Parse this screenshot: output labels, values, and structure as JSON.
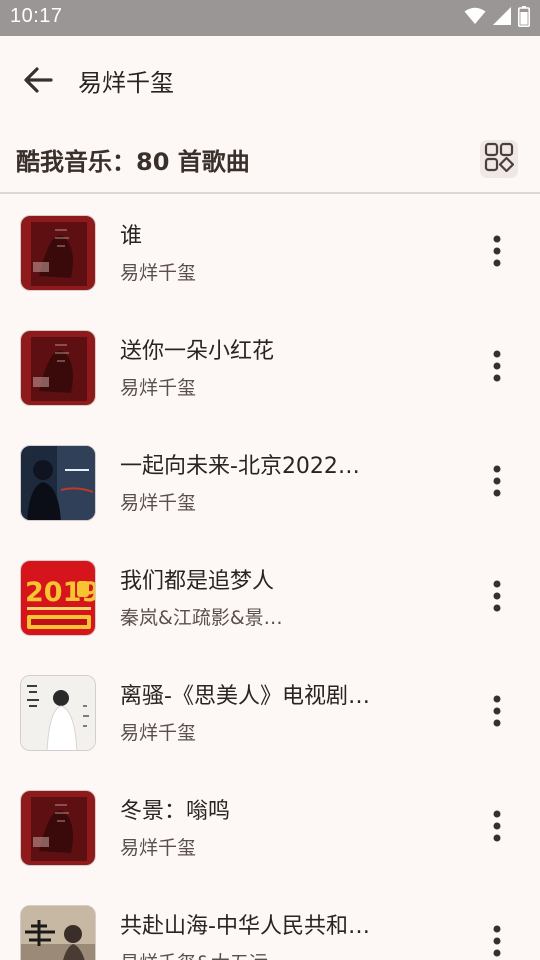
{
  "status_bar": {
    "time": "10:17",
    "icons": [
      "wifi-icon",
      "cellular-signal-icon",
      "battery-icon"
    ]
  },
  "app_bar": {
    "back_icon": "arrow-left-icon",
    "title": "易烊千玺"
  },
  "section": {
    "title": "酷我音乐：80 首歌曲",
    "view_toggle_icon": "grid-view-icon"
  },
  "songs": [
    {
      "title": "谁",
      "artist": "易烊千玺",
      "cover": "red-poster-cover"
    },
    {
      "title": "送你一朵小红花",
      "artist": "易烊千玺",
      "cover": "red-poster-cover"
    },
    {
      "title": "一起向未来-北京2022…",
      "artist": "易烊千玺",
      "cover": "dark-portrait-cover"
    },
    {
      "title": "我们都是追梦人",
      "artist": "秦岚&江疏影&景…",
      "cover": "spring-gala-2019-cover"
    },
    {
      "title": "离骚-《思美人》电视剧…",
      "artist": "易烊千玺",
      "cover": "white-costume-cover"
    },
    {
      "title": "冬景：嗡鸣",
      "artist": "易烊千玺",
      "cover": "red-poster-cover"
    },
    {
      "title": "共赴山海-中华人民共和…",
      "artist": "易烊千玺&大五运",
      "cover": "shanhai-calligraphy-cover"
    }
  ],
  "colors": {
    "background": "#fdf8f6",
    "status_bar": "#9a9695",
    "divider": "#dcd6d4",
    "text_primary": "#2b2322",
    "text_secondary": "#5a4f4b"
  }
}
